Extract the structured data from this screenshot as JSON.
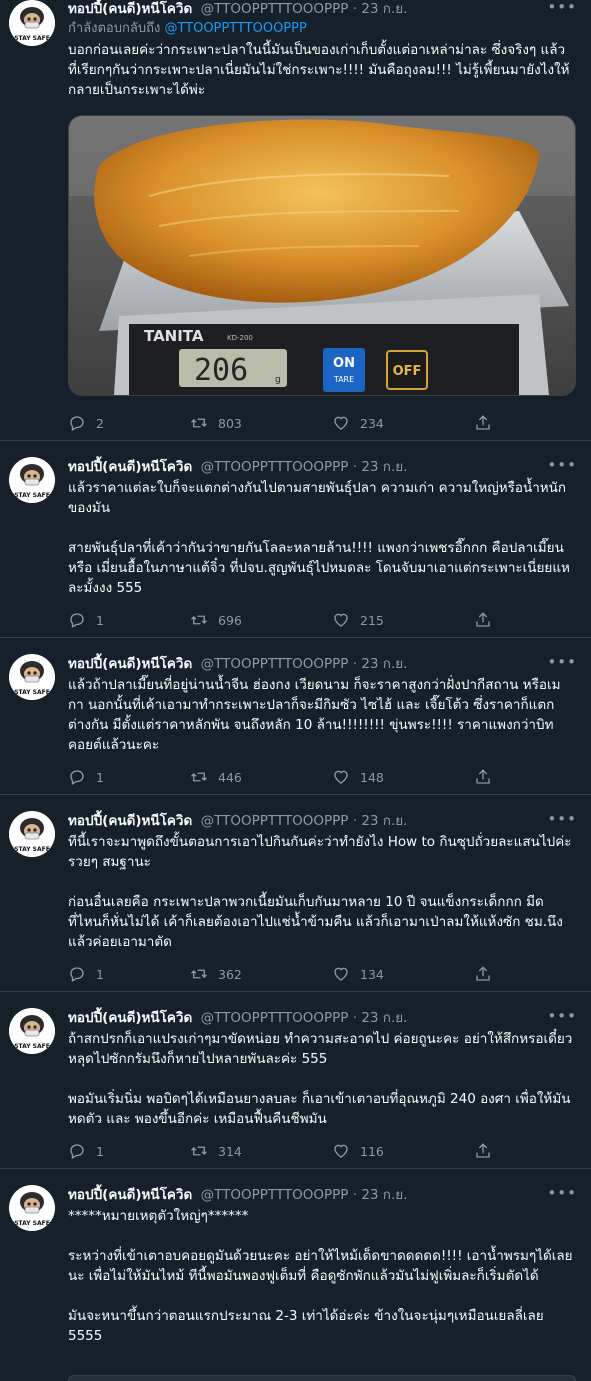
{
  "colors": {
    "background": "#15202b",
    "text": "#f7f9f9",
    "muted": "#8b98a5",
    "link": "#1d9bf0",
    "border": "#38444d"
  },
  "avatar_badge": "STAY SAFE",
  "tweets": [
    {
      "name": "ทอปปี้(คนดี)หนีโควิด",
      "handle": "@TTOOPPTTTOOOPPP",
      "dot": "·",
      "date": "23 ก.ย.",
      "reply_prefix": "กำลังตอบกลับถึง",
      "reply_mention": "@TTOOPPTTTOOOPPP",
      "paragraphs": [
        "บอกก่อนเลยค่ะว่ากระเพาะปลาในนี้มันเป็นของเก่าเก็บตั้งแต่อาเหล่าม่าละ ซึ่งจริงๆ แล้วที่เรียกๆกันว่ากระเพาะปลาเนี่ยมันไม่ใช่กระเพาะ!!!! มันคือถุงลม!!! ไม่รู้เพี้ยนมายังไงให้กลายเป็นกระเพาะได้พ่ะ"
      ],
      "image": {
        "scale_brand": "TANITA",
        "scale_model": "KD-200",
        "display": "206",
        "unit": "g",
        "button_on": "ON",
        "button_tare": "TARE",
        "button_off": "OFF"
      },
      "replies": "2",
      "retweets": "803",
      "likes": "234"
    },
    {
      "name": "ทอปปี้(คนดี)หนีโควิด",
      "handle": "@TTOOPPTTTOOOPPP",
      "dot": "·",
      "date": "23 ก.ย.",
      "paragraphs": [
        "แล้วราคาแต่ละใบก็จะแตกต่างกันไปตามสายพันธุ์ปลา ความเก่า ความใหญ่หรือน้ำหนักของมัน",
        "สายพันธุ์ปลาที่เค้าว่ากันว่าขายกันโลละหลายล้าน!!!! แพงกว่าเพชรอี๊กกก คือปลาเมี๊ยน หรือ เมี่ยนฮื้อในภาษาแต้จิ๋ว ที่ปจบ.สูญพันธุ์ไปหมดละ โดนจับมาเอาแต่กระเพาะเนี่ยยแหละมั้งงง 555"
      ],
      "replies": "1",
      "retweets": "696",
      "likes": "215"
    },
    {
      "name": "ทอปปี้(คนดี)หนีโควิด",
      "handle": "@TTOOPPTTTOOOPPP",
      "dot": "·",
      "date": "23 ก.ย.",
      "paragraphs": [
        "แล้วถ้าปลาเมี๊ยนที่อยู่น่านน้ำจีน ฮ่องกง เวียดนาม ก็จะราคาสูงกว่าฝั่งปากีสถาน หรือเมกา นอกนั้นที่เค้าเอามาทำกระเพาะปลาก็จะมีกิมซัว ไซไฮ้ และ เจี๊ยโต้ว ซึ่งราคาก็แตกต่างกัน มีตั้งแต่ราคาหลักพัน จนถึงหลัก 10 ล้าน!!!!!!!! ขุ่นพระ!!!! ราคาแพงกว่าบิทคอยต์แล้วนะคะ"
      ],
      "replies": "1",
      "retweets": "446",
      "likes": "148"
    },
    {
      "name": "ทอปปี้(คนดี)หนีโควิด",
      "handle": "@TTOOPPTTTOOOPPP",
      "dot": "·",
      "date": "23 ก.ย.",
      "paragraphs": [
        "ทีนี้เราจะมาพูดถึงขั้นตอนการเอาไปกินกันค่ะว่าทำยังไง How to กินซุปถั่วยละแสนไปค่ะ รวยๆ สมฐานะ",
        "ก่อนอื่นเลยคือ กระเพาะปลาพวกเนี้ยมันเก็บกันมาหลาย 10 ปี จนแข็งกระเด็กกก มีดที่ไหนก็หั่นไม่ได้ เค้าก็เลยต้องเอาไปแช่น้ำข้ามคืน แล้วก็เอามาเป่าลมให้แห้งซัก ชม.นึง แล้วค่อยเอามาตัด"
      ],
      "replies": "1",
      "retweets": "362",
      "likes": "134"
    },
    {
      "name": "ทอปปี้(คนดี)หนีโควิด",
      "handle": "@TTOOPPTTTOOOPPP",
      "dot": "·",
      "date": "23 ก.ย.",
      "paragraphs": [
        "ถ้าสกปรกก็เอาแปรงเก่าๆมาขัดหน่อย ทำความสะอาดไป ค่อยถูนะคะ อย่าให้สึกหรอเดี๋ยวหลุดไปซักกรัมนึงก็หายไปหลายพันละค่ะ 555",
        "พอมันเริ่มนิ่ม พอบิดๆได้เหมือนยางลบละ ก็เอาเข้าเตาอบที่อุณหภูมิ 240 องศา เพื่อให้มันหดตัว และ พองขึ้นอีกค่ะ เหมือนฟื้นคืนชีพมัน"
      ],
      "replies": "1",
      "retweets": "314",
      "likes": "116"
    },
    {
      "name": "ทอปปี้(คนดี)หนีโควิด",
      "handle": "@TTOOPPTTTOOOPPP",
      "dot": "·",
      "date": "23 ก.ย.",
      "paragraphs": [
        "*****หมายเหตุตัวใหญ่ๆ******",
        "ระหว่างที่เข้าเตาอบคอยดูมันด้วยนะคะ อย่าให้ไหม้เด็ดขาดดดดด!!!! เอาน้ำพรมๆได้เลยนะ เพื่อไม่ให้มันไหม้ ทีนี้พอมันพองฟูเต็มที่ คือดูซักพักแล้วมันไม่ฟูเพิ่มละก็เริ่มตัดได้",
        "มันจะหนาขึ้นกว่าตอนแรกประมาณ 2-3 เท่าได้อ่ะค่ะ ข้างในจะนุ่มๆเหมือนเยลลี่เลย 5555"
      ]
    }
  ]
}
